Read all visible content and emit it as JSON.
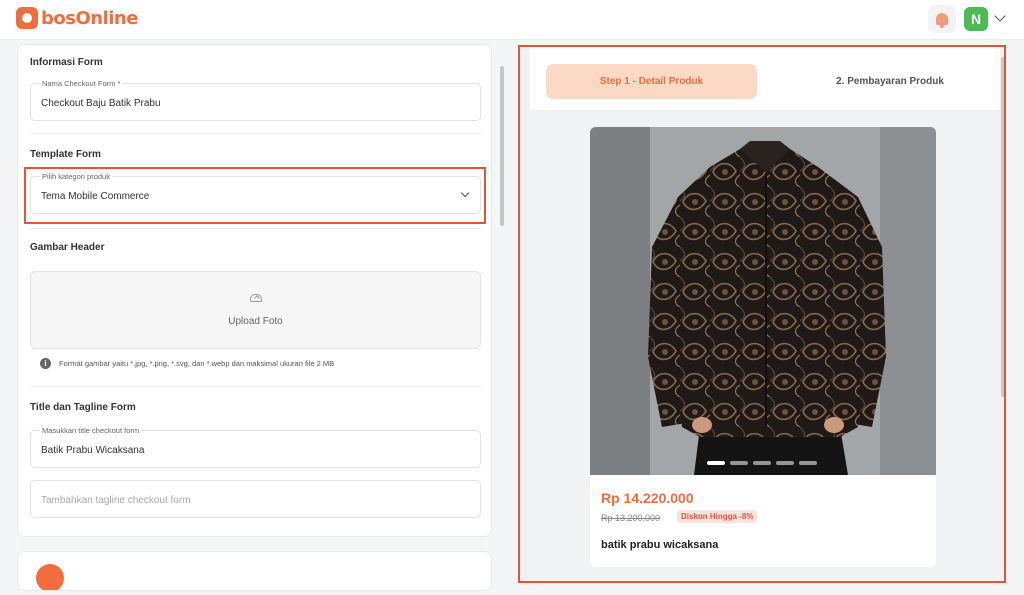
{
  "app": {
    "logo_text": "bosOnline",
    "avatar_initial": "N"
  },
  "form": {
    "informasi": {
      "title": "Informasi Form",
      "name_label": "Nama Checkout Form *",
      "name_value": "Checkout Baju Batik Prabu"
    },
    "template": {
      "title": "Template Form",
      "category_label": "Pilih kategori produk",
      "category_value": "Tema Mobile Commerce"
    },
    "header_image": {
      "title": "Gambar Header",
      "upload_label": "Upload Foto",
      "format_note": "Format gambar yaitu *.jpg, *.png, *.svg, dan *.webp dan maksimal ukuran file 2 MB"
    },
    "title_tagline": {
      "title": "Title dan Tagline Form",
      "title_label": "Masukkan title checkout form",
      "title_value": "Batik Prabu Wicaksana",
      "tagline_placeholder": "Tambahkan tagline checkout form"
    }
  },
  "preview": {
    "step1_label": "Step 1 - Detail Produk",
    "step2_label": "2. Pembayaran Produk",
    "product": {
      "price": "Rp 14.220.000",
      "old_price": "Rp 13.200.000",
      "discount_badge": "Diskon Hingga -8%",
      "name": "batik prabu wicaksana"
    },
    "carousel": {
      "total": 5,
      "active": 1
    }
  },
  "colors": {
    "brand": "#f26d3d",
    "highlight": "#e5533d",
    "avatar": "#4cbb55"
  },
  "icons": [
    "logo-icon",
    "bell-icon",
    "chevron-down-icon",
    "upload-icon",
    "info-icon"
  ]
}
